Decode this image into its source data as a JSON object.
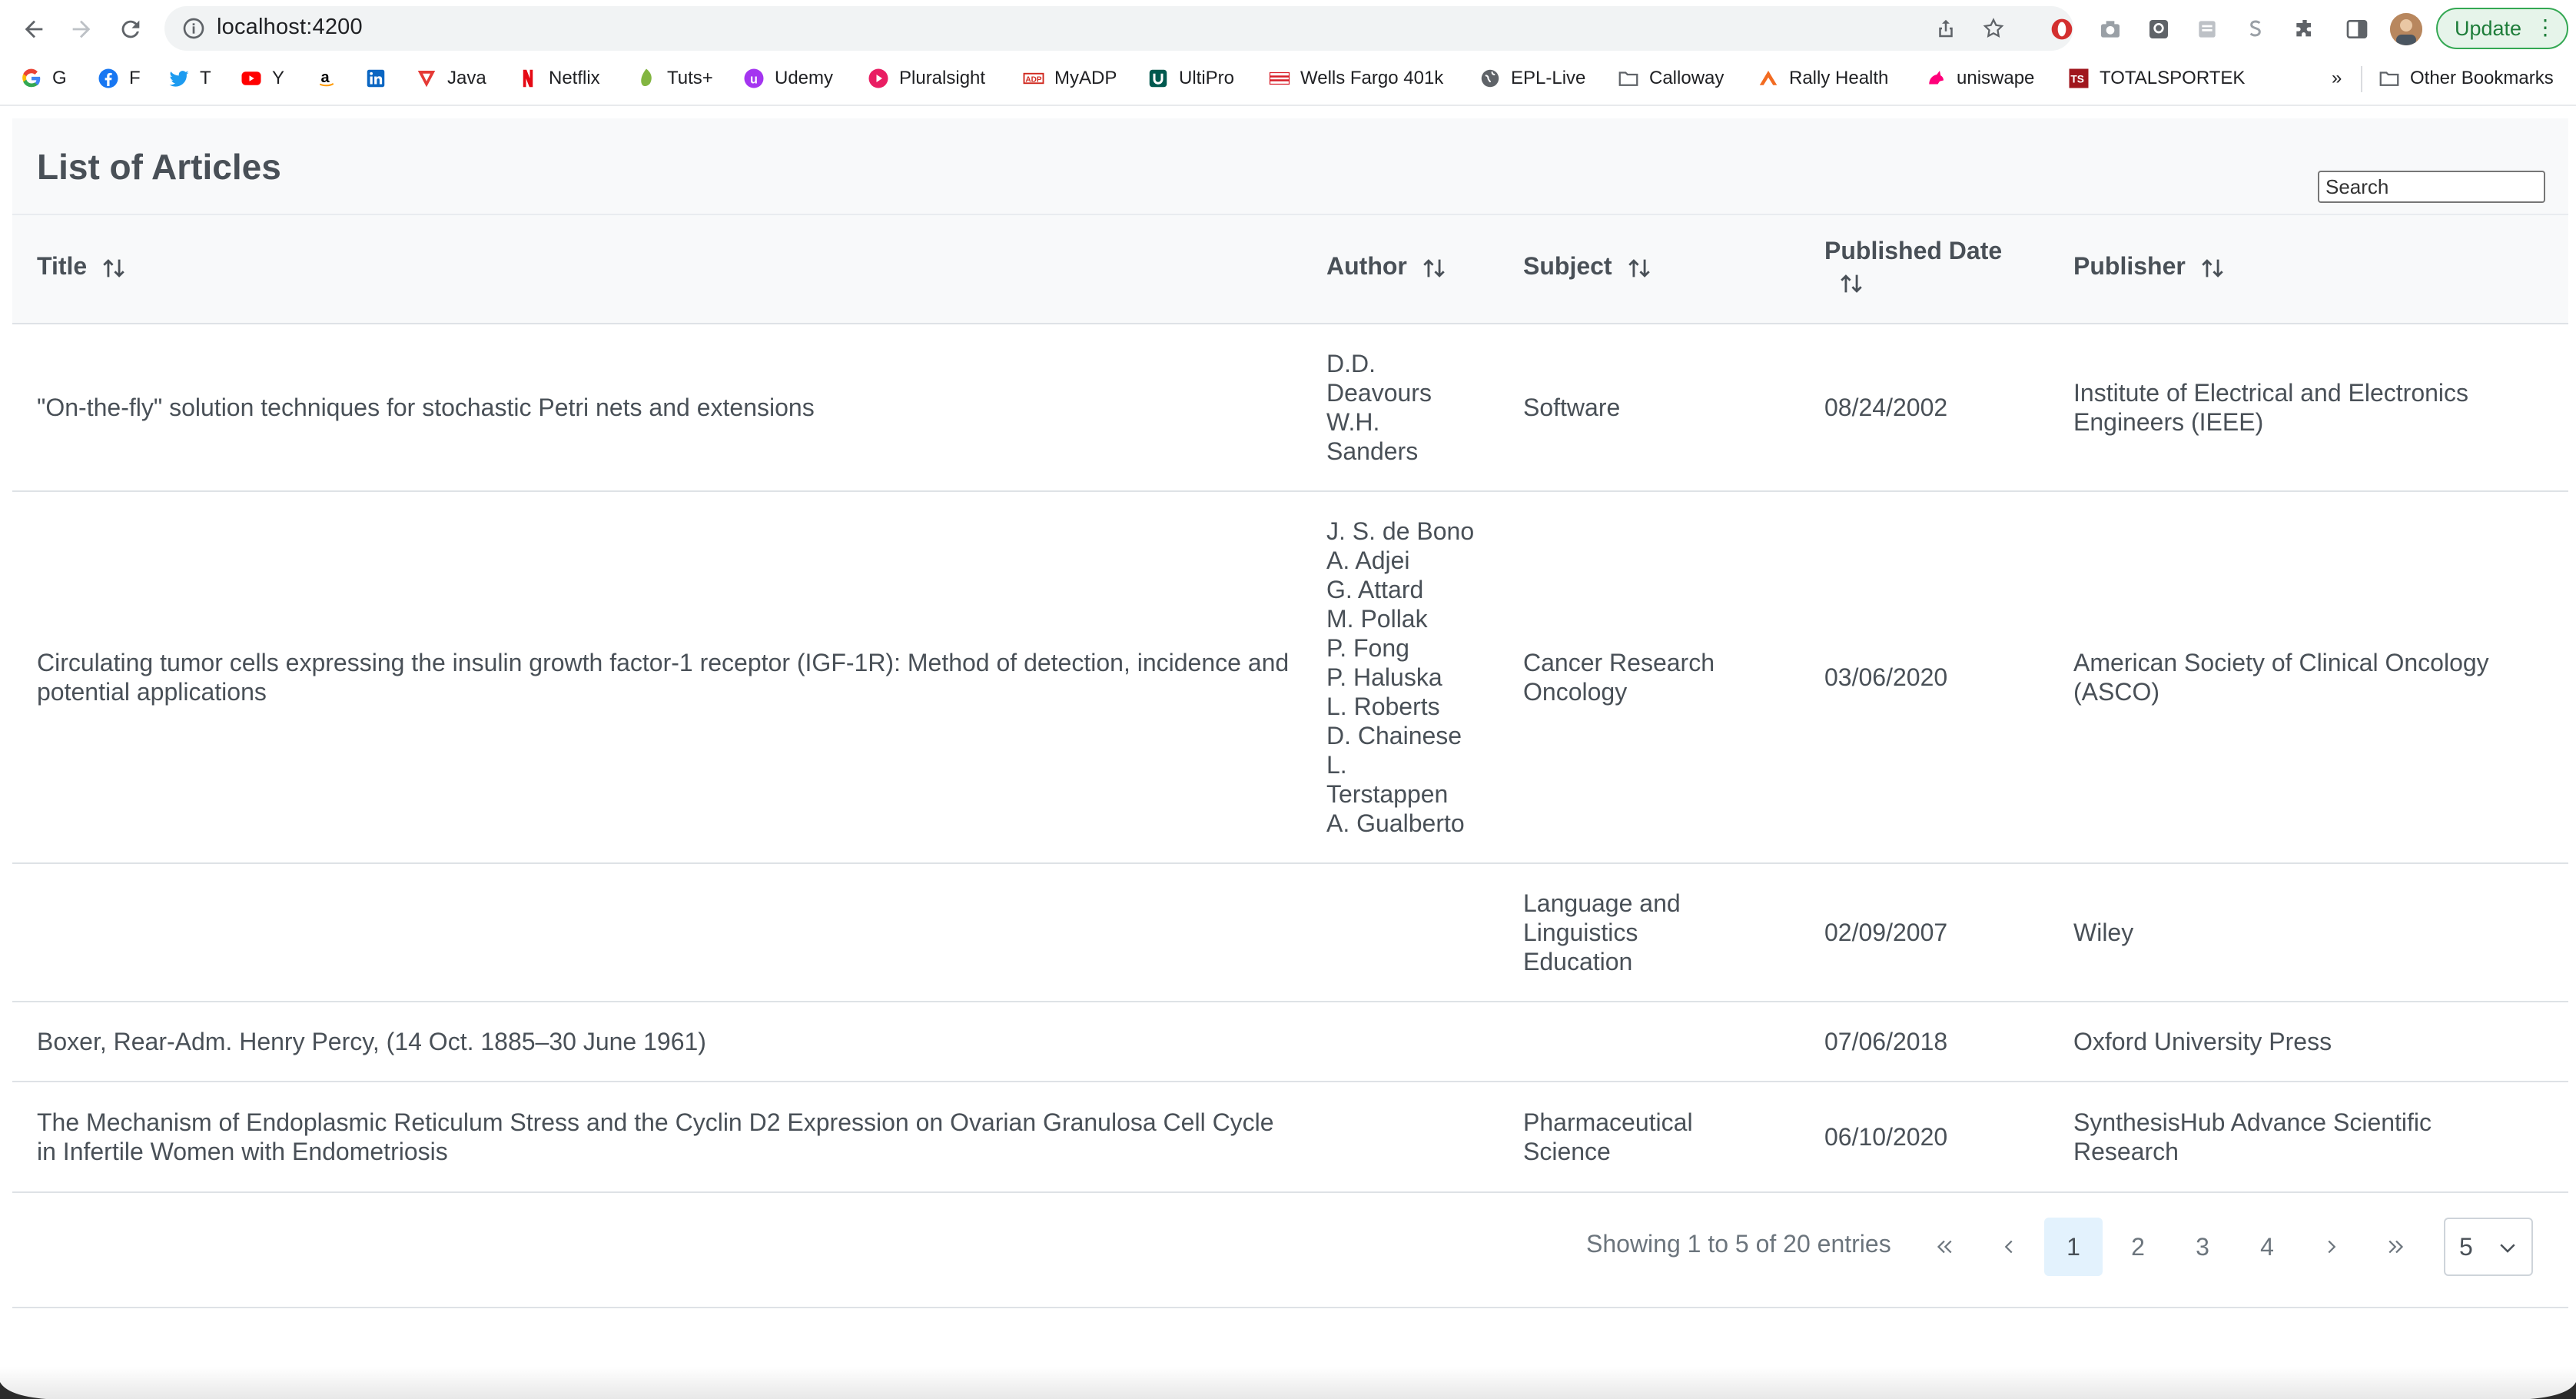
{
  "browser": {
    "url": "localhost:4200",
    "update_label": "Update",
    "bookmarks": [
      {
        "label": "G",
        "icon": "google-icon",
        "color": "#4285f4"
      },
      {
        "label": "F",
        "icon": "facebook-icon",
        "color": "#1877f2"
      },
      {
        "label": "T",
        "icon": "twitter-icon",
        "color": "#1d9bf0"
      },
      {
        "label": "Y",
        "icon": "youtube-icon",
        "color": "#ff0000"
      },
      {
        "label": "",
        "icon": "amazon-icon",
        "color": "#000000"
      },
      {
        "label": "",
        "icon": "linkedin-icon",
        "color": "#0a66c2"
      },
      {
        "label": "Java",
        "icon": "java-v-icon",
        "color": "#e53935"
      },
      {
        "label": "Netflix",
        "icon": "netflix-icon",
        "color": "#e50914"
      },
      {
        "label": "Tuts+",
        "icon": "tuts-leaf-icon",
        "color": "#82b541"
      },
      {
        "label": "Udemy",
        "icon": "udemy-icon",
        "color": "#a435f0"
      },
      {
        "label": "Pluralsight",
        "icon": "pluralsight-icon",
        "color": "#f15b2a"
      },
      {
        "label": "MyADP",
        "icon": "adp-icon",
        "color": "#d0271d"
      },
      {
        "label": "UltiPro",
        "icon": "ultipro-icon",
        "color": "#00594f"
      },
      {
        "label": "Wells Fargo 401k",
        "icon": "wells-fargo-icon",
        "color": "#d71e28"
      },
      {
        "label": "EPL-Live",
        "icon": "globe-icon",
        "color": "#5f6368"
      },
      {
        "label": "Calloway",
        "icon": "folder-icon",
        "color": "#5f6368"
      },
      {
        "label": "Rally Health",
        "icon": "rally-icon",
        "color": "#f26b21"
      },
      {
        "label": "uniswape",
        "icon": "unicorn-icon",
        "color": "#ff007a"
      },
      {
        "label": "TOTALSPORTEK",
        "icon": "ts-icon",
        "color": "#a0161d"
      }
    ],
    "overflow_label": "»",
    "other_bookmarks": "Other Bookmarks"
  },
  "page": {
    "title": "List of Articles",
    "search_placeholder": "Search"
  },
  "table": {
    "columns": [
      "Title",
      "Author",
      "Subject",
      "Published Date",
      "Publisher"
    ],
    "rows": [
      {
        "title": "\"On-the-fly\" solution techniques for stochastic Petri nets and extensions",
        "authors": [
          "D.D.",
          "Deavours",
          "W.H.",
          "Sanders"
        ],
        "subject": "Software",
        "date": "08/24/2002",
        "publisher": "Institute of Electrical and Electronics Engineers (IEEE)"
      },
      {
        "title": "Circulating tumor cells expressing the insulin growth factor-1 receptor (IGF-1R): Method of detection, incidence and potential applications",
        "authors": [
          "J. S. de Bono",
          "A. Adjei",
          "G. Attard",
          "M. Pollak",
          "P. Fong",
          "P. Haluska",
          "L. Roberts",
          "D. Chainese",
          "L.",
          "Terstappen",
          "A. Gualberto"
        ],
        "subject": "Cancer Research Oncology",
        "date": "03/06/2020",
        "publisher": "American Society of Clinical Oncology (ASCO)"
      },
      {
        "title": "",
        "authors": [],
        "subject": "Language and Linguistics Education",
        "date": "02/09/2007",
        "publisher": "Wiley"
      },
      {
        "title": "Boxer, Rear-Adm. Henry Percy, (14 Oct. 1885–30 June 1961)",
        "authors": [],
        "subject": "",
        "date": "07/06/2018",
        "publisher": "Oxford University Press"
      },
      {
        "title": "The Mechanism of Endoplasmic Reticulum Stress and the Cyclin D2 Expression on Ovarian Granulosa Cell Cycle in Infertile Women with Endometriosis",
        "authors": [],
        "subject": "Pharmaceutical Science",
        "date": "06/10/2020",
        "publisher": "SynthesisHub Advance Scientific Research"
      }
    ]
  },
  "paginator": {
    "report": "Showing 1 to 5 of 20 entries",
    "pages": [
      "1",
      "2",
      "3",
      "4"
    ],
    "current_page": "1",
    "rows_per_page": "5"
  },
  "colors": {
    "header_bg": "#f8f9fa",
    "text": "#495057",
    "active_page_bg": "#e3f2fd",
    "update_green": "#34a853"
  }
}
